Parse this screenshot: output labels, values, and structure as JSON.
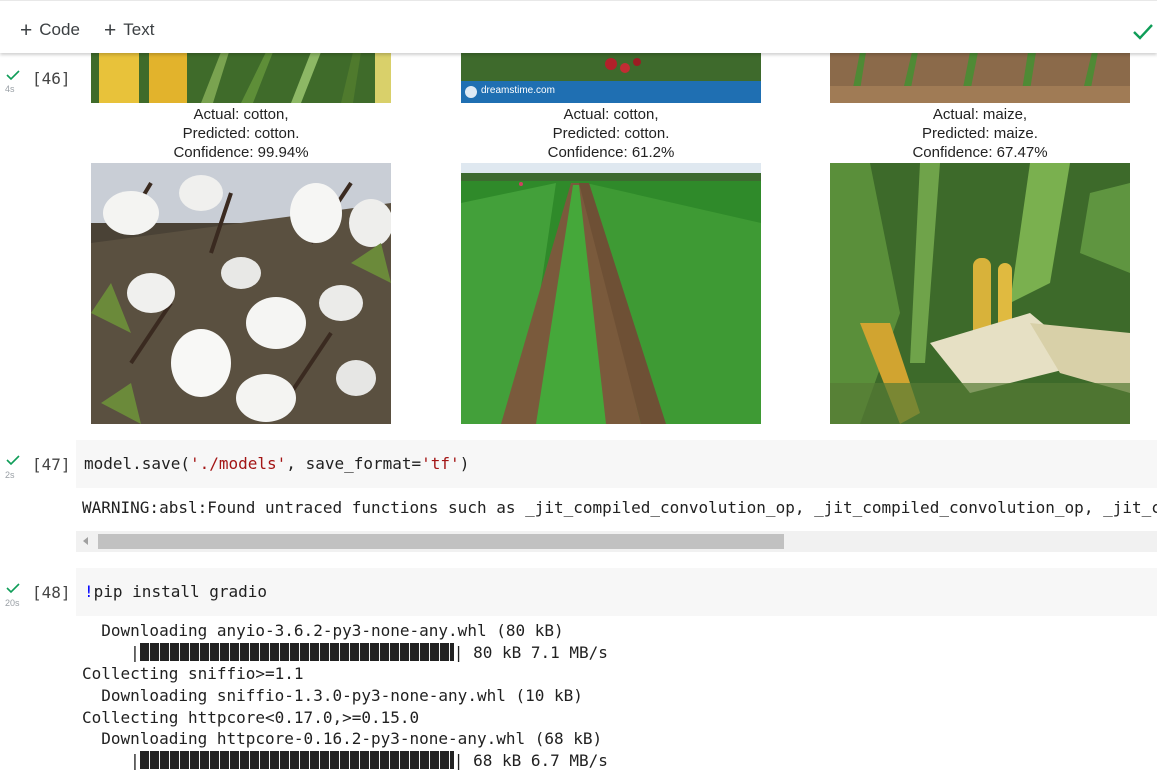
{
  "toolbar": {
    "code_label": "Code",
    "text_label": "Text"
  },
  "cells": {
    "c46": {
      "count": "[46]",
      "time": "4s"
    },
    "c47": {
      "count": "[47]",
      "time": "2s",
      "code": {
        "prefix": "model.save(",
        "arg1": "'./models'",
        "mid": ", save_format=",
        "arg2": "'tf'",
        "suffix": ")"
      },
      "warning": "WARNING:absl:Found untraced functions such as _jit_compiled_convolution_op, _jit_compiled_convolution_op, _jit_c"
    },
    "c48": {
      "count": "[48]",
      "time": "20s",
      "code": {
        "bang": "!",
        "rest": "pip install gradio"
      }
    }
  },
  "predictions": [
    {
      "actual": "Actual: cotton,",
      "predicted": "Predicted: cotton.",
      "confidence": "Confidence: 99.94%"
    },
    {
      "actual": "Actual: cotton,",
      "predicted": "Predicted: cotton.",
      "confidence": "Confidence: 61.2%"
    },
    {
      "actual": "Actual: maize,",
      "predicted": "Predicted: maize.",
      "confidence": "Confidence: 67.47%"
    }
  ],
  "watermark": "dreamstime.com",
  "pip_output": {
    "l1": "  Downloading anyio-3.6.2-py3-none-any.whl (80 kB)",
    "l2_pre": "     |",
    "l2_post": "| 80 kB 7.1 MB/s",
    "l3": "Collecting sniffio>=1.1",
    "l4": "  Downloading sniffio-1.3.0-py3-none-any.whl (10 kB)",
    "l5": "Collecting httpcore<0.17.0,>=0.15.0",
    "l6": "  Downloading httpcore-0.16.2-py3-none-any.whl (68 kB)",
    "l7_pre": "     |",
    "l7_post": "| 68 kB 6.7 MB/s"
  },
  "colors": {
    "check": "#0f9d58",
    "string": "#a31515",
    "bang": "#0000ff"
  }
}
